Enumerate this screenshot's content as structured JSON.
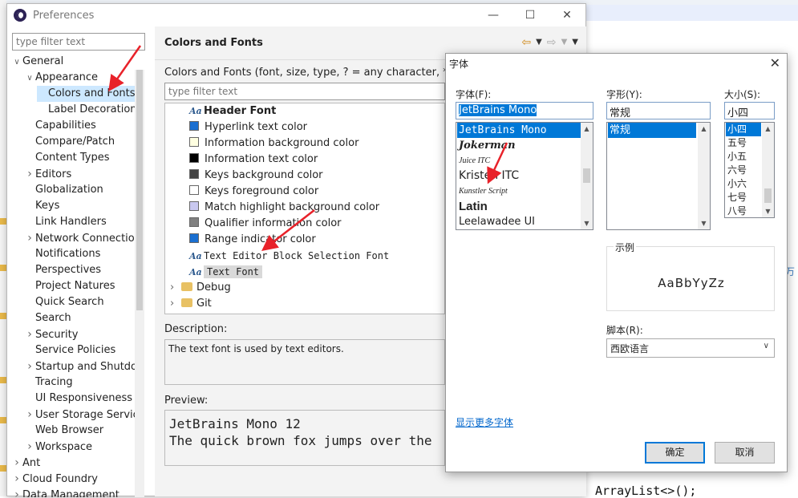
{
  "preferences": {
    "title": "Preferences",
    "filter_placeholder": "type filter text",
    "tree": [
      {
        "label": "General",
        "depth": 0,
        "arrow": "open"
      },
      {
        "label": "Appearance",
        "depth": 1,
        "arrow": "open"
      },
      {
        "label": "Colors and Fonts",
        "depth": 2,
        "arrow": "none",
        "selected": true
      },
      {
        "label": "Label Decorations",
        "depth": 2,
        "arrow": "none"
      },
      {
        "label": "Capabilities",
        "depth": 1,
        "arrow": "none"
      },
      {
        "label": "Compare/Patch",
        "depth": 1,
        "arrow": "none"
      },
      {
        "label": "Content Types",
        "depth": 1,
        "arrow": "none"
      },
      {
        "label": "Editors",
        "depth": 1,
        "arrow": "closed"
      },
      {
        "label": "Globalization",
        "depth": 1,
        "arrow": "none"
      },
      {
        "label": "Keys",
        "depth": 1,
        "arrow": "none"
      },
      {
        "label": "Link Handlers",
        "depth": 1,
        "arrow": "none"
      },
      {
        "label": "Network Connections",
        "depth": 1,
        "arrow": "closed"
      },
      {
        "label": "Notifications",
        "depth": 1,
        "arrow": "none"
      },
      {
        "label": "Perspectives",
        "depth": 1,
        "arrow": "none"
      },
      {
        "label": "Project Natures",
        "depth": 1,
        "arrow": "none"
      },
      {
        "label": "Quick Search",
        "depth": 1,
        "arrow": "none"
      },
      {
        "label": "Search",
        "depth": 1,
        "arrow": "none"
      },
      {
        "label": "Security",
        "depth": 1,
        "arrow": "closed"
      },
      {
        "label": "Service Policies",
        "depth": 1,
        "arrow": "none"
      },
      {
        "label": "Startup and Shutdown",
        "depth": 1,
        "arrow": "closed"
      },
      {
        "label": "Tracing",
        "depth": 1,
        "arrow": "none"
      },
      {
        "label": "UI Responsiveness",
        "depth": 1,
        "arrow": "none"
      },
      {
        "label": "User Storage Service",
        "depth": 1,
        "arrow": "closed"
      },
      {
        "label": "Web Browser",
        "depth": 1,
        "arrow": "none"
      },
      {
        "label": "Workspace",
        "depth": 1,
        "arrow": "closed"
      },
      {
        "label": "Ant",
        "depth": 0,
        "arrow": "closed"
      },
      {
        "label": "Cloud Foundry",
        "depth": 0,
        "arrow": "closed"
      },
      {
        "label": "Data Management",
        "depth": 0,
        "arrow": "closed"
      }
    ],
    "page_title": "Colors and Fonts",
    "cf_description": "Colors and Fonts (font, size, type, ? = any character, * = any",
    "items": [
      {
        "label": "Header Font",
        "kind": "font",
        "bold": true
      },
      {
        "label": "Hyperlink text color",
        "kind": "color",
        "color": "#1a6fd1"
      },
      {
        "label": "Information background color",
        "kind": "color",
        "color": "#ffffe1"
      },
      {
        "label": "Information text color",
        "kind": "color",
        "color": "#000000"
      },
      {
        "label": "Keys background color",
        "kind": "color",
        "color": "#444444"
      },
      {
        "label": "Keys foreground color",
        "kind": "color",
        "color": "#ffffff"
      },
      {
        "label": "Match highlight background color",
        "kind": "color",
        "color": "#c9c8f0"
      },
      {
        "label": "Qualifier information color",
        "kind": "color",
        "color": "#808080"
      },
      {
        "label": "Range indicator color",
        "kind": "color",
        "color": "#1a6fd1"
      },
      {
        "label": "Text Editor Block Selection Font",
        "kind": "font",
        "mono": true
      },
      {
        "label": "Text Font",
        "kind": "font",
        "mono": true,
        "selected": true
      },
      {
        "label": "Debug",
        "kind": "folder"
      },
      {
        "label": "Git",
        "kind": "folder"
      }
    ],
    "description_label": "Description:",
    "description_text": "The text font is used by text editors.",
    "preview_label": "Preview:",
    "preview_line1": "JetBrains Mono 12",
    "preview_line2": "The quick brown fox jumps over the"
  },
  "font_dialog": {
    "title": "字体",
    "font_label": "字体(F):",
    "font_value": "JetBrains Mono",
    "fonts": [
      "JetBrains Mono",
      "Jokerman",
      "Juice ITC",
      "Kristen ITC",
      "Kunstler Script",
      "Latin",
      "Leelawadee UI"
    ],
    "style_label": "字形(Y):",
    "style_value": "常规",
    "styles": [
      "常规"
    ],
    "size_label": "大小(S):",
    "size_value": "小四",
    "sizes": [
      "小四",
      "五号",
      "小五",
      "六号",
      "小六",
      "七号",
      "八号"
    ],
    "sample_label": "示例",
    "sample_text": "AaBbYyZz",
    "script_label": "脚本(R):",
    "script_value": "西欧语言",
    "more_fonts_link": "显示更多字体",
    "ok_label": "确定",
    "cancel_label": "取消"
  },
  "background": {
    "code_snippet": "ArrayList<>();",
    "side_text": "万"
  }
}
